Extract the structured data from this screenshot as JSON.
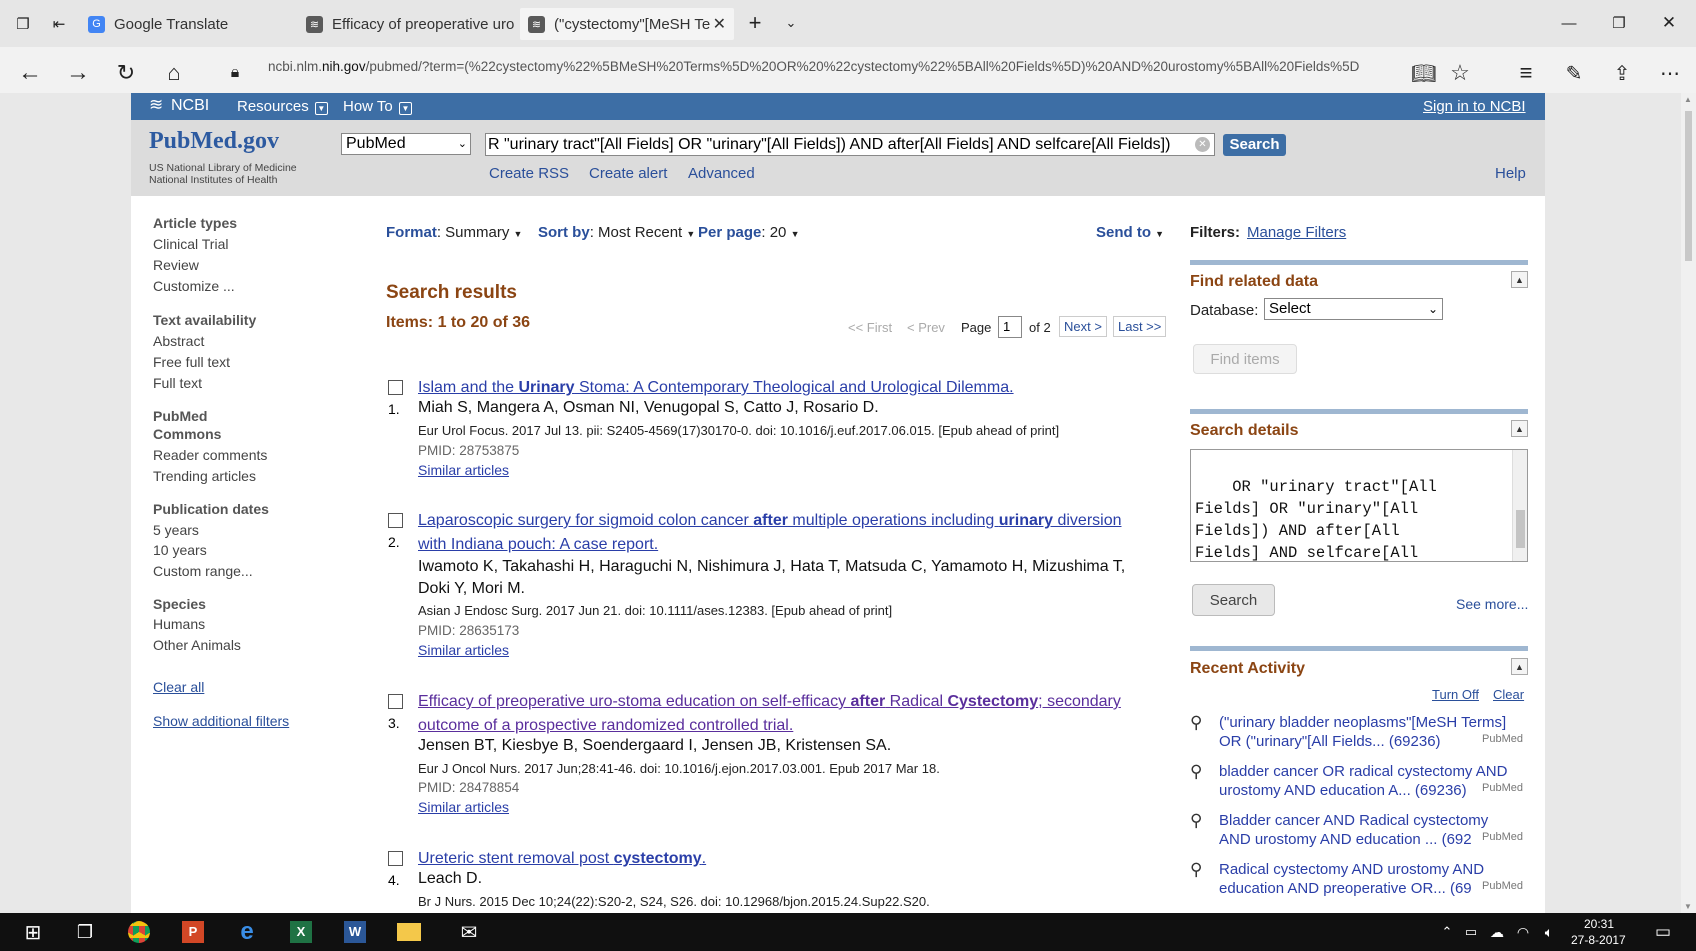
{
  "browser": {
    "tabs": [
      {
        "label": "Google Translate",
        "icon": "google-translate-icon"
      },
      {
        "label": "Efficacy of preoperative uro",
        "icon": "ncbi-icon"
      },
      {
        "label": "(\"cystectomy\"[MeSH Te",
        "icon": "ncbi-icon"
      }
    ],
    "url_host_prefix": "ncbi.nlm.",
    "url_host_main": "nih.gov",
    "url_path": "/pubmed/?term=(%22cystectomy%22%5BMeSH%20Terms%5D%20OR%20%22cystectomy%22%5BAll%20Fields%5D)%20AND%20urostomy%5BAll%20Fields%5D"
  },
  "ncbi": {
    "logo": "NCBI",
    "resources": "Resources",
    "howto": "How To",
    "signin": "Sign in to NCBI"
  },
  "header": {
    "logo_text": "PubMed.gov",
    "logo_line1": "US National Library of Medicine",
    "logo_line2": "National Institutes of Health",
    "db_select": "PubMed",
    "search_value": "R \"urinary tract\"[All Fields] OR \"urinary\"[All Fields]) AND after[All Fields] AND selfcare[All Fields])",
    "search_button": "Search",
    "create_rss": "Create RSS",
    "create_alert": "Create alert",
    "advanced": "Advanced",
    "help": "Help"
  },
  "sidebar": {
    "article_types": "Article types",
    "article_items": [
      "Clinical Trial",
      "Review",
      "Customize ..."
    ],
    "text_availability": "Text availability",
    "text_items": [
      "Abstract",
      "Free full text",
      "Full text"
    ],
    "pubmed_commons_1": "PubMed",
    "pubmed_commons_2": "Commons",
    "commons_items": [
      "Reader comments",
      "Trending articles"
    ],
    "publication_dates": "Publication dates",
    "date_items": [
      "5 years",
      "10 years",
      "Custom range..."
    ],
    "species": "Species",
    "species_items": [
      "Humans",
      "Other Animals"
    ],
    "clear_all": "Clear all",
    "show_filters": "Show additional filters"
  },
  "toolbar": {
    "format_label": "Format",
    "format_value": ": Summary",
    "sort_label": "Sort by",
    "sort_value": ": Most Recent",
    "perpage_label": "Per page",
    "perpage_value": ": 20",
    "send_to": "Send to"
  },
  "results": {
    "heading": "Search results",
    "items_count": "Items: 1 to 20 of 36",
    "pager": {
      "first": "<< First",
      "prev": "< Prev",
      "page_label": "Page",
      "page_value": "1",
      "of": "of 2",
      "next": "Next >",
      "last": "Last >>"
    },
    "items": [
      {
        "num": "1.",
        "title_html": "Islam and the <b>Urinary</b> Stoma: A Contemporary Theological and Urological Dilemma.",
        "authors": "Miah S, Mangera A, Osman NI, Venugopal S, Catto J, Rosario D.",
        "cite": "Eur Urol Focus. 2017 Jul 13. pii: S2405-4569(17)30170-0. doi: 10.1016/j.euf.2017.06.015. [Epub ahead of print]",
        "pmid": "PMID: 28753875",
        "similar": "Similar articles"
      },
      {
        "num": "2.",
        "title_html": "Laparoscopic surgery for sigmoid colon cancer <b>after</b> multiple operations including <b>urinary</b> diversion with Indiana pouch: A case report.",
        "authors": "Iwamoto K, Takahashi H, Haraguchi N, Nishimura J, Hata T, Matsuda C, Yamamoto H, Mizushima T, Doki Y, Mori M.",
        "cite": "Asian J Endosc Surg. 2017 Jun 21. doi: 10.1111/ases.12383. [Epub ahead of print]",
        "pmid": "PMID: 28635173",
        "similar": "Similar articles"
      },
      {
        "num": "3.",
        "title_html": "Efficacy of preoperative uro-stoma education on self-efficacy <b>after</b> Radical <b>Cystectomy</b>; secondary outcome of a prospective randomized controlled trial.",
        "authors": "Jensen BT, Kiesbye B, Soendergaard I, Jensen JB, Kristensen SA.",
        "cite": "Eur J Oncol Nurs. 2017 Jun;28:41-46. doi: 10.1016/j.ejon.2017.03.001. Epub 2017 Mar 18.",
        "pmid": "PMID: 28478854",
        "similar": "Similar articles"
      },
      {
        "num": "4.",
        "title_html": "Ureteric stent removal post <b>cystectomy</b>.",
        "authors": "Leach D.",
        "cite": "Br J Nurs. 2015 Dec 10;24(22):S20-2, S24, S26. doi: 10.12968/bjon.2015.24.Sup22.S20."
      }
    ]
  },
  "right": {
    "filters_label": "Filters:",
    "manage_filters": "Manage Filters",
    "find_related": "Find related data",
    "database_label": "Database:",
    "database_value": "Select",
    "find_items": "Find items",
    "search_details": "Search details",
    "details_text": "OR \"urinary tract\"[All\nFields] OR \"urinary\"[All\nFields]) AND after[All\nFields] AND selfcare[All\nFields])",
    "search_button": "Search",
    "see_more": "See more...",
    "recent_activity": "Recent Activity",
    "turn_off": "Turn Off",
    "clear": "Clear",
    "recent_items": [
      {
        "line1": "(\"urinary bladder neoplasms\"[MeSH Terms]",
        "line2": "OR (\"urinary\"[All Fields... (69236)",
        "tag": "PubMed"
      },
      {
        "line1": "bladder cancer OR radical cystectomy AND",
        "line2": "urostomy AND education A... (69236)",
        "tag": "PubMed"
      },
      {
        "line1": "Bladder cancer AND Radical cystectomy",
        "line2": "AND urostomy AND education ... (692",
        "tag": "PubMed"
      },
      {
        "line1": "Radical cystectomy AND urostomy AND",
        "line2": "education AND preoperative OR... (69",
        "tag": "PubMed"
      }
    ]
  },
  "taskbar": {
    "time": "20:31",
    "date": "27-8-2017"
  }
}
